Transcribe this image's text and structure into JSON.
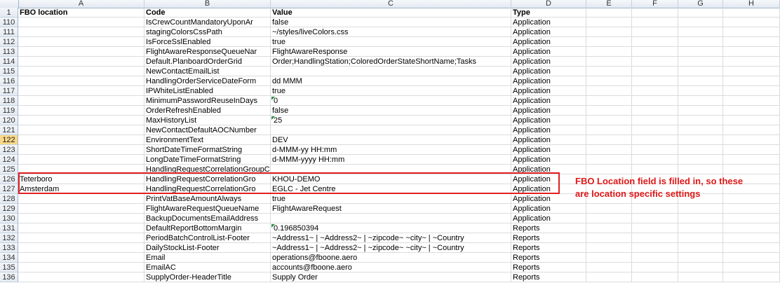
{
  "columns": [
    "A",
    "B",
    "C",
    "D",
    "E",
    "F",
    "G",
    "H"
  ],
  "header_row": {
    "number": "1",
    "cells": [
      "FBO location",
      "Code",
      "Value",
      "Type"
    ]
  },
  "rows": [
    {
      "n": "110",
      "a": "",
      "b": "IsCrewCountMandatoryUponAr",
      "c": "false",
      "d": "Application",
      "tri": false
    },
    {
      "n": "111",
      "a": "",
      "b": "stagingColorsCssPath",
      "c": "~/styles/liveColors.css",
      "d": "Application",
      "tri": false
    },
    {
      "n": "112",
      "a": "",
      "b": "IsForceSslEnabled",
      "c": "true",
      "d": "Application",
      "tri": false
    },
    {
      "n": "113",
      "a": "",
      "b": "FlightAwareResponseQueueNar",
      "c": "FlightAwareResponse",
      "d": "Application",
      "tri": false
    },
    {
      "n": "114",
      "a": "",
      "b": "Default.PlanboardOrderGrid",
      "c": "Order;HandlingStation;ColoredOrderStateShortName;Tasks",
      "d": "Application",
      "tri": false
    },
    {
      "n": "115",
      "a": "",
      "b": "NewContactEmailList",
      "c": "",
      "d": "Application",
      "tri": false
    },
    {
      "n": "116",
      "a": "",
      "b": "HandlingOrderServiceDateForm",
      "c": "dd MMM",
      "d": "Application",
      "tri": false
    },
    {
      "n": "117",
      "a": "",
      "b": "IPWhiteListEnabled",
      "c": "true",
      "d": "Application",
      "tri": false
    },
    {
      "n": "118",
      "a": "",
      "b": "MinimumPasswordReuseInDays",
      "c": "0",
      "d": "Application",
      "tri": true
    },
    {
      "n": "119",
      "a": "",
      "b": "OrderRefreshEnabled",
      "c": "false",
      "d": "Application",
      "tri": false
    },
    {
      "n": "120",
      "a": "",
      "b": "MaxHistoryList",
      "c": "25",
      "d": "Application",
      "tri": true
    },
    {
      "n": "121",
      "a": "",
      "b": "NewContactDefaultAOCNumber",
      "c": "",
      "d": "Application",
      "tri": false
    },
    {
      "n": "122",
      "a": "",
      "b": "EnvironmentText",
      "c": "DEV",
      "d": "Application",
      "tri": false,
      "selected": true
    },
    {
      "n": "123",
      "a": "",
      "b": "ShortDateTimeFormatString",
      "c": "d-MMM-yy HH:mm",
      "d": "Application",
      "tri": false
    },
    {
      "n": "124",
      "a": "",
      "b": "LongDateTimeFormatString",
      "c": "d-MMM-yyyy HH:mm",
      "d": "Application",
      "tri": false
    },
    {
      "n": "125",
      "a": "",
      "b": "HandlingRequestCorrelationGroupCode",
      "c": "",
      "d": "Application",
      "tri": false
    },
    {
      "n": "126",
      "a": "Teterboro",
      "b": "HandlingRequestCorrelationGro",
      "c": "KHOU-DEMO",
      "d": "Application",
      "tri": false
    },
    {
      "n": "127",
      "a": "Amsterdam",
      "b": "HandlingRequestCorrelationGro",
      "c": "EGLC - Jet Centre",
      "d": "Application",
      "tri": false
    },
    {
      "n": "128",
      "a": "",
      "b": "PrintVatBaseAmountAlways",
      "c": "true",
      "d": "Application",
      "tri": false
    },
    {
      "n": "129",
      "a": "",
      "b": "FlightAwareRequestQueueName",
      "c": "FlightAwareRequest",
      "d": "Application",
      "tri": false
    },
    {
      "n": "130",
      "a": "",
      "b": "BackupDocumentsEmailAddress",
      "c": "",
      "d": "Application",
      "tri": false
    },
    {
      "n": "131",
      "a": "",
      "b": "DefaultReportBottomMargin",
      "c": "0.196850394",
      "d": "Reports",
      "tri": true
    },
    {
      "n": "132",
      "a": "",
      "b": "PeriodBatchControlList-Footer",
      "c": "~Address1~ | ~Address2~ | ~zipcode~ ~city~ | ~Country",
      "d": "Reports",
      "tri": false
    },
    {
      "n": "133",
      "a": "",
      "b": "DailyStockList-Footer",
      "c": "~Address1~ | ~Address2~ | ~zipcode~ ~city~ | ~Country",
      "d": "Reports",
      "tri": false
    },
    {
      "n": "134",
      "a": "",
      "b": "Email",
      "c": "operations@fboone.aero",
      "d": "Reports",
      "tri": false
    },
    {
      "n": "135",
      "a": "",
      "b": "EmailAC",
      "c": "accounts@fboone.aero",
      "d": "Reports",
      "tri": false
    },
    {
      "n": "136",
      "a": "",
      "b": "SupplyOrder-HeaderTitle",
      "c": "Supply Order",
      "d": "Reports",
      "tri": false
    }
  ],
  "annotation": {
    "line1": "FBO Location field is filled in, so these",
    "line2": "are location specific settings",
    "color": "#e01818"
  }
}
